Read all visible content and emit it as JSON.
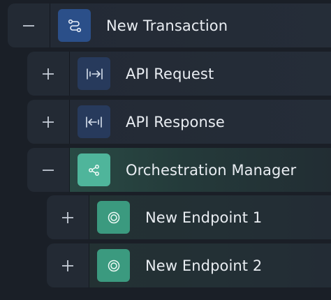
{
  "tree": {
    "items": [
      {
        "label": "New Transaction",
        "toggle": "collapse",
        "icon": "transaction-flow-icon",
        "icon_color": "#2b4f89"
      },
      {
        "label": "API Request",
        "toggle": "expand",
        "icon": "request-arrow-icon",
        "icon_color": "#273a5c"
      },
      {
        "label": "API Response",
        "toggle": "expand",
        "icon": "response-arrow-icon",
        "icon_color": "#273a5c"
      },
      {
        "label": "Orchestration Manager",
        "toggle": "collapse",
        "icon": "share-nodes-icon",
        "icon_color": "#4fb59b"
      },
      {
        "label": "New Endpoint 1",
        "toggle": "expand",
        "icon": "target-icon",
        "icon_color": "#3b9a7f"
      },
      {
        "label": "New Endpoint 2",
        "toggle": "expand",
        "icon": "target-icon",
        "icon_color": "#3b9a7f"
      }
    ]
  }
}
